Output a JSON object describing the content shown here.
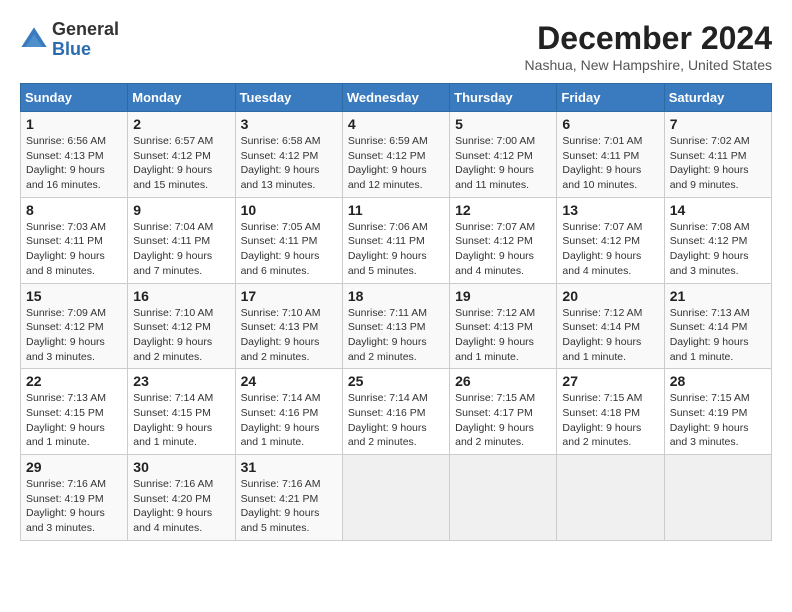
{
  "logo": {
    "general": "General",
    "blue": "Blue"
  },
  "header": {
    "month": "December 2024",
    "location": "Nashua, New Hampshire, United States"
  },
  "weekdays": [
    "Sunday",
    "Monday",
    "Tuesday",
    "Wednesday",
    "Thursday",
    "Friday",
    "Saturday"
  ],
  "weeks": [
    [
      {
        "day": "1",
        "info": "Sunrise: 6:56 AM\nSunset: 4:13 PM\nDaylight: 9 hours\nand 16 minutes."
      },
      {
        "day": "2",
        "info": "Sunrise: 6:57 AM\nSunset: 4:12 PM\nDaylight: 9 hours\nand 15 minutes."
      },
      {
        "day": "3",
        "info": "Sunrise: 6:58 AM\nSunset: 4:12 PM\nDaylight: 9 hours\nand 13 minutes."
      },
      {
        "day": "4",
        "info": "Sunrise: 6:59 AM\nSunset: 4:12 PM\nDaylight: 9 hours\nand 12 minutes."
      },
      {
        "day": "5",
        "info": "Sunrise: 7:00 AM\nSunset: 4:12 PM\nDaylight: 9 hours\nand 11 minutes."
      },
      {
        "day": "6",
        "info": "Sunrise: 7:01 AM\nSunset: 4:11 PM\nDaylight: 9 hours\nand 10 minutes."
      },
      {
        "day": "7",
        "info": "Sunrise: 7:02 AM\nSunset: 4:11 PM\nDaylight: 9 hours\nand 9 minutes."
      }
    ],
    [
      {
        "day": "8",
        "info": "Sunrise: 7:03 AM\nSunset: 4:11 PM\nDaylight: 9 hours\nand 8 minutes."
      },
      {
        "day": "9",
        "info": "Sunrise: 7:04 AM\nSunset: 4:11 PM\nDaylight: 9 hours\nand 7 minutes."
      },
      {
        "day": "10",
        "info": "Sunrise: 7:05 AM\nSunset: 4:11 PM\nDaylight: 9 hours\nand 6 minutes."
      },
      {
        "day": "11",
        "info": "Sunrise: 7:06 AM\nSunset: 4:11 PM\nDaylight: 9 hours\nand 5 minutes."
      },
      {
        "day": "12",
        "info": "Sunrise: 7:07 AM\nSunset: 4:12 PM\nDaylight: 9 hours\nand 4 minutes."
      },
      {
        "day": "13",
        "info": "Sunrise: 7:07 AM\nSunset: 4:12 PM\nDaylight: 9 hours\nand 4 minutes."
      },
      {
        "day": "14",
        "info": "Sunrise: 7:08 AM\nSunset: 4:12 PM\nDaylight: 9 hours\nand 3 minutes."
      }
    ],
    [
      {
        "day": "15",
        "info": "Sunrise: 7:09 AM\nSunset: 4:12 PM\nDaylight: 9 hours\nand 3 minutes."
      },
      {
        "day": "16",
        "info": "Sunrise: 7:10 AM\nSunset: 4:12 PM\nDaylight: 9 hours\nand 2 minutes."
      },
      {
        "day": "17",
        "info": "Sunrise: 7:10 AM\nSunset: 4:13 PM\nDaylight: 9 hours\nand 2 minutes."
      },
      {
        "day": "18",
        "info": "Sunrise: 7:11 AM\nSunset: 4:13 PM\nDaylight: 9 hours\nand 2 minutes."
      },
      {
        "day": "19",
        "info": "Sunrise: 7:12 AM\nSunset: 4:13 PM\nDaylight: 9 hours\nand 1 minute."
      },
      {
        "day": "20",
        "info": "Sunrise: 7:12 AM\nSunset: 4:14 PM\nDaylight: 9 hours\nand 1 minute."
      },
      {
        "day": "21",
        "info": "Sunrise: 7:13 AM\nSunset: 4:14 PM\nDaylight: 9 hours\nand 1 minute."
      }
    ],
    [
      {
        "day": "22",
        "info": "Sunrise: 7:13 AM\nSunset: 4:15 PM\nDaylight: 9 hours\nand 1 minute."
      },
      {
        "day": "23",
        "info": "Sunrise: 7:14 AM\nSunset: 4:15 PM\nDaylight: 9 hours\nand 1 minute."
      },
      {
        "day": "24",
        "info": "Sunrise: 7:14 AM\nSunset: 4:16 PM\nDaylight: 9 hours\nand 1 minute."
      },
      {
        "day": "25",
        "info": "Sunrise: 7:14 AM\nSunset: 4:16 PM\nDaylight: 9 hours\nand 2 minutes."
      },
      {
        "day": "26",
        "info": "Sunrise: 7:15 AM\nSunset: 4:17 PM\nDaylight: 9 hours\nand 2 minutes."
      },
      {
        "day": "27",
        "info": "Sunrise: 7:15 AM\nSunset: 4:18 PM\nDaylight: 9 hours\nand 2 minutes."
      },
      {
        "day": "28",
        "info": "Sunrise: 7:15 AM\nSunset: 4:19 PM\nDaylight: 9 hours\nand 3 minutes."
      }
    ],
    [
      {
        "day": "29",
        "info": "Sunrise: 7:16 AM\nSunset: 4:19 PM\nDaylight: 9 hours\nand 3 minutes."
      },
      {
        "day": "30",
        "info": "Sunrise: 7:16 AM\nSunset: 4:20 PM\nDaylight: 9 hours\nand 4 minutes."
      },
      {
        "day": "31",
        "info": "Sunrise: 7:16 AM\nSunset: 4:21 PM\nDaylight: 9 hours\nand 5 minutes."
      },
      {
        "day": "",
        "info": ""
      },
      {
        "day": "",
        "info": ""
      },
      {
        "day": "",
        "info": ""
      },
      {
        "day": "",
        "info": ""
      }
    ]
  ]
}
